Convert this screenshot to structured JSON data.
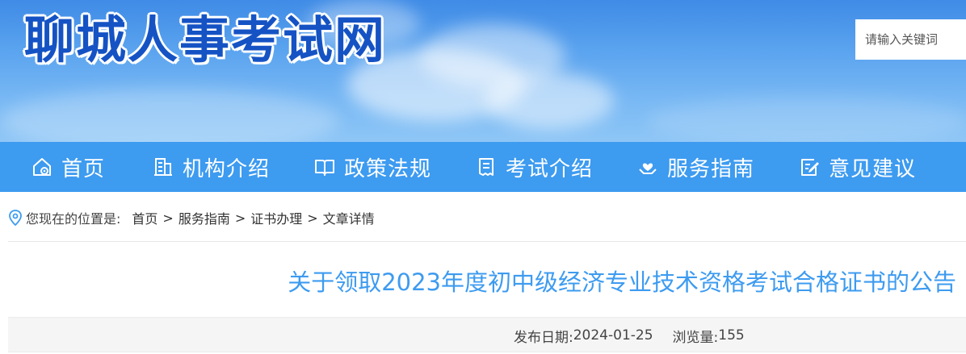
{
  "header": {
    "site_title": "聊城人事考试网",
    "search_placeholder": "请输入关键词"
  },
  "nav": {
    "items": [
      {
        "label": "首页",
        "icon": "home-icon"
      },
      {
        "label": "机构介绍",
        "icon": "building-icon"
      },
      {
        "label": "政策法规",
        "icon": "book-icon"
      },
      {
        "label": "考试介绍",
        "icon": "document-icon"
      },
      {
        "label": "服务指南",
        "icon": "heart-hand-icon"
      },
      {
        "label": "意见建议",
        "icon": "edit-icon"
      }
    ]
  },
  "breadcrumb": {
    "prefix": "您现在的位置是:",
    "items": [
      "首页",
      "服务指南",
      "证书办理",
      "文章详情"
    ],
    "separator": ">"
  },
  "article": {
    "title": "关于领取2023年度初中级经济专业技术资格考试合格证书的公告",
    "date_label": "发布日期:",
    "date": "2024-01-25",
    "views_label": "浏览量:",
    "views": "155"
  },
  "colors": {
    "nav_bg": "#3d9bf0",
    "title_color": "#3d9bf0",
    "logo_color": "#1553c4"
  }
}
